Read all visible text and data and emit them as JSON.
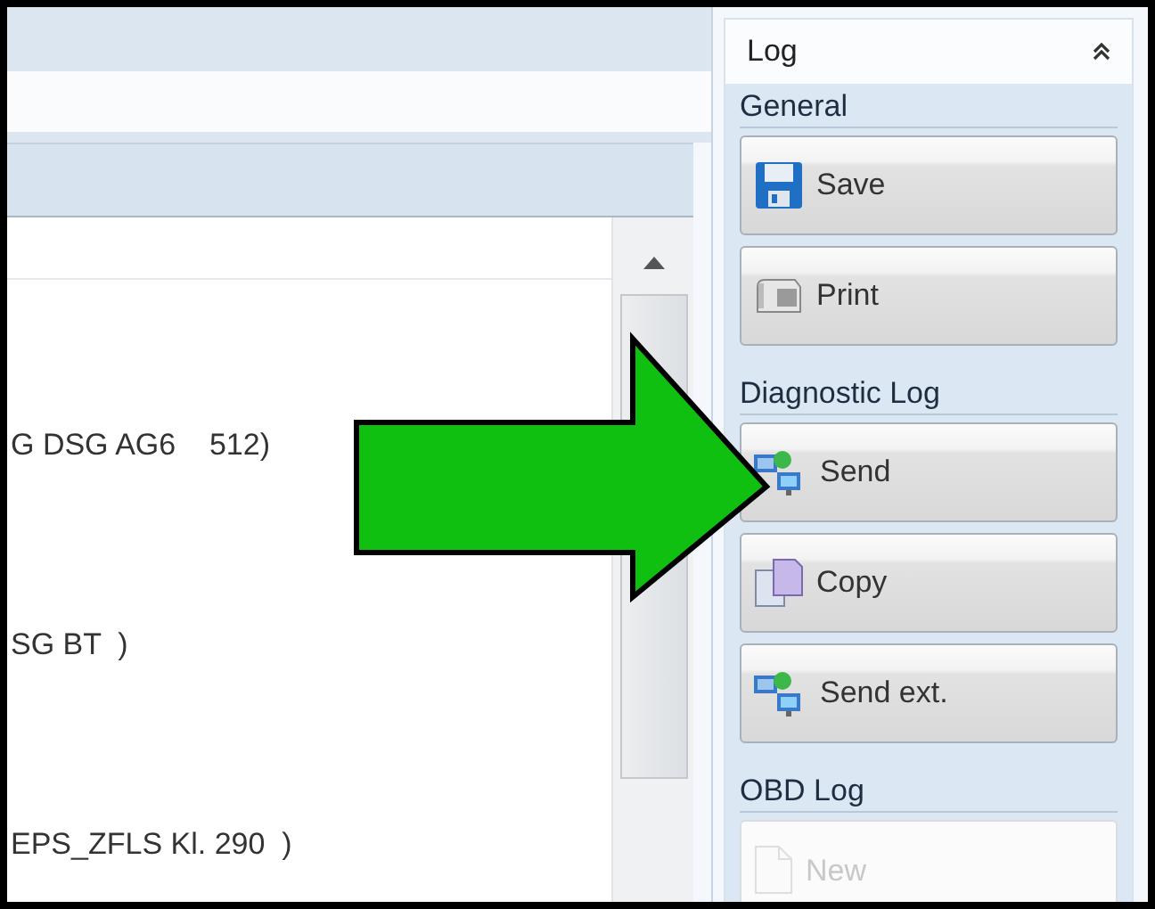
{
  "list_rows": [
    "G DSG AG6    512)",
    "SG BT  )",
    "EPS_ZFLS Kl. 290  )"
  ],
  "log_panel": {
    "title": "Log",
    "expanded": true,
    "sections": [
      {
        "title": "General",
        "buttons": [
          {
            "label": "Save",
            "kind": "save",
            "disabled": false
          },
          {
            "label": "Print",
            "kind": "print",
            "disabled": false
          }
        ]
      },
      {
        "title": "Diagnostic Log",
        "buttons": [
          {
            "label": "Send",
            "kind": "send",
            "disabled": false
          },
          {
            "label": "Copy",
            "kind": "copy",
            "disabled": false
          },
          {
            "label": "Send ext.",
            "kind": "send",
            "disabled": false
          }
        ]
      },
      {
        "title": "OBD Log",
        "buttons": [
          {
            "label": "New",
            "kind": "new",
            "disabled": true
          }
        ]
      }
    ]
  }
}
